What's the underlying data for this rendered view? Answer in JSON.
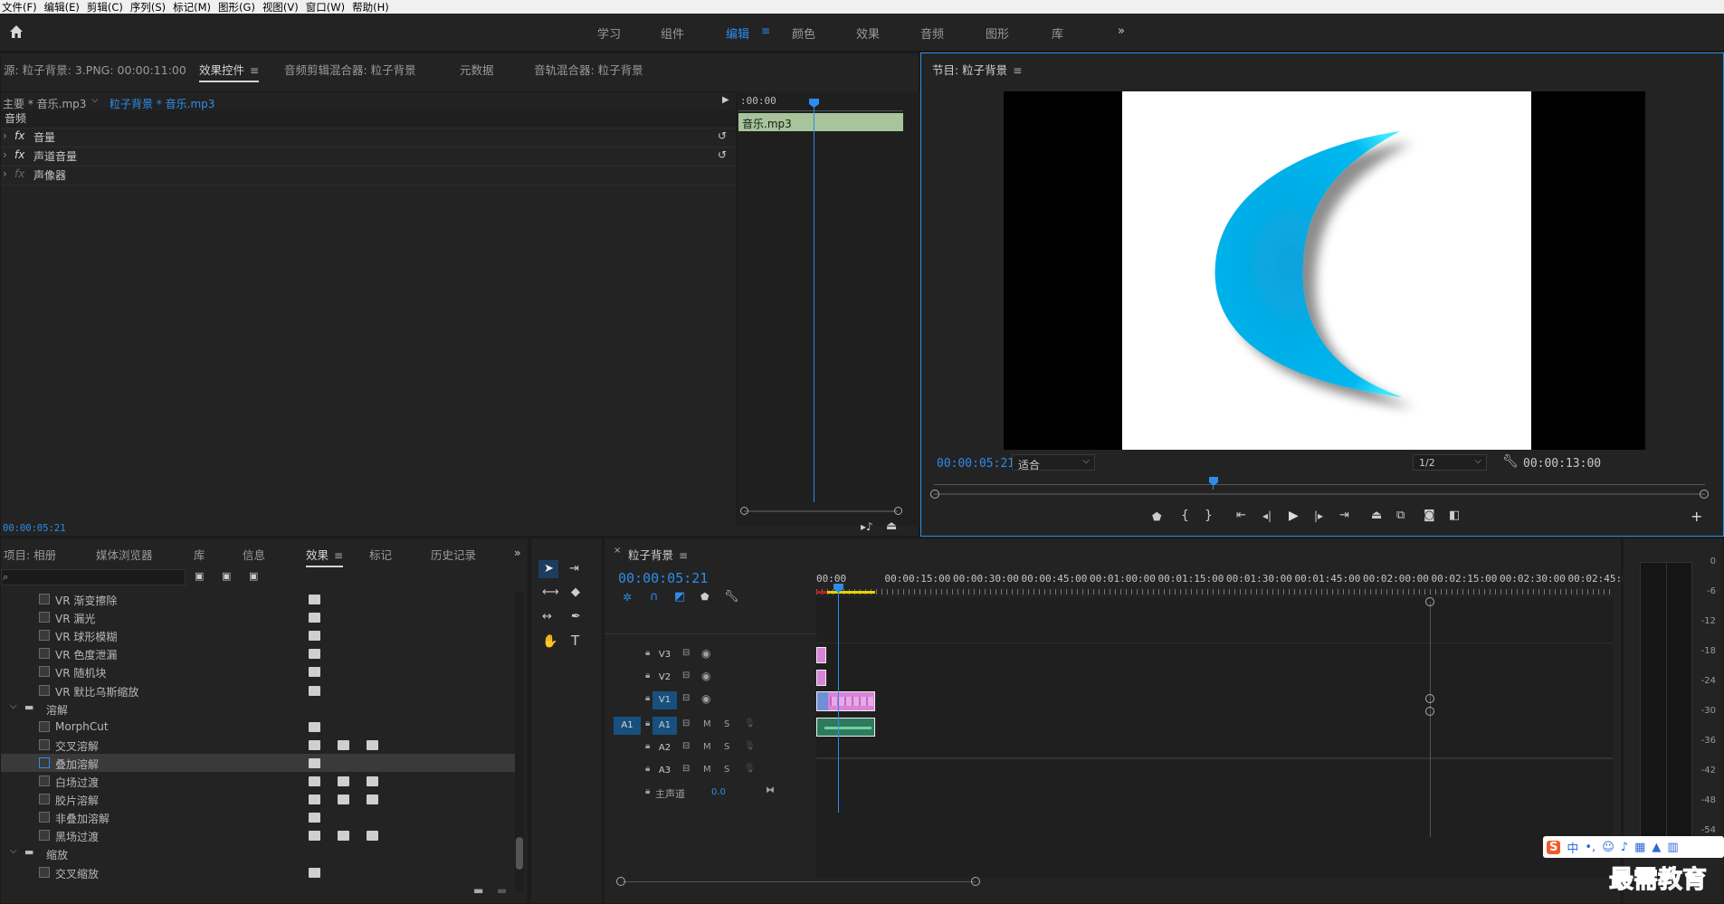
{
  "menu": [
    "文件(F)",
    "编辑(E)",
    "剪辑(C)",
    "序列(S)",
    "标记(M)",
    "图形(G)",
    "视图(V)",
    "窗口(W)",
    "帮助(H)"
  ],
  "workspaces": [
    "学习",
    "组件",
    "编辑",
    "颜色",
    "效果",
    "音频",
    "图形",
    "库"
  ],
  "workspace_active": "编辑",
  "source_panel": {
    "tabs": [
      "源: 粒子背景: 3.PNG: 00:00:11:00",
      "效果控件",
      "音频剪辑混合器: 粒子背景",
      "元数据",
      "音轨混合器: 粒子背景"
    ],
    "clip_master": "主要 * 音乐.mp3",
    "clip_active": "粒子背景 * 音乐.mp3",
    "timecode_start": ":00:00",
    "clip_bar": "音乐.mp3",
    "section": "音频",
    "effects": [
      "音量",
      "声道音量",
      "声像器"
    ],
    "timecode": "00:00:05:21"
  },
  "program": {
    "title": "节目: 粒子背景",
    "timecode": "00:00:05:21",
    "fit": "适合",
    "resolution": "1/2",
    "duration": "00:00:13:00"
  },
  "project_panel": {
    "tabs": [
      "项目: 相册",
      "媒体浏览器",
      "库",
      "信息",
      "效果",
      "标记",
      "历史记录"
    ],
    "active_tab": "效果",
    "items": [
      {
        "label": "VR 渐变擦除",
        "prefix": ""
      },
      {
        "label": "VR 漏光",
        "prefix": ""
      },
      {
        "label": "VR 球形模糊",
        "prefix": ""
      },
      {
        "label": "VR 色度泄漏",
        "prefix": ""
      },
      {
        "label": "VR 随机块",
        "prefix": ""
      },
      {
        "label": "VR 默比乌斯缩放",
        "prefix": ""
      },
      {
        "label": "溶解",
        "folder": true
      },
      {
        "label": "MorphCut"
      },
      {
        "label": "交叉溶解"
      },
      {
        "label": "叠加溶解",
        "selected": true
      },
      {
        "label": "白场过渡"
      },
      {
        "label": "胶片溶解"
      },
      {
        "label": "非叠加溶解"
      },
      {
        "label": "黑场过渡"
      },
      {
        "label": "缩放",
        "folder": true
      },
      {
        "label": "交叉缩放"
      }
    ]
  },
  "timeline": {
    "title": "粒子背景",
    "timecode": "00:00:05:21",
    "ruler": [
      "00:00",
      "00:00:15:00",
      "00:00:30:00",
      "00:00:45:00",
      "00:01:00:00",
      "00:01:15:00",
      "00:01:30:00",
      "00:01:45:00",
      "00:02:00:00",
      "00:02:15:00",
      "00:02:30:00",
      "00:02:45:00"
    ],
    "video_tracks": [
      "V3",
      "V2",
      "V1"
    ],
    "audio_tracks": [
      "A1",
      "A2",
      "A3"
    ],
    "source_patch": "A1",
    "mute": "M",
    "solo": "S",
    "master_label": "主声道",
    "master_value": "0.0"
  },
  "meter_labels": [
    "0",
    "-6",
    "-12",
    "-18",
    "-24",
    "-30",
    "-36",
    "-42",
    "-48",
    "-54"
  ],
  "ime": {
    "label": "中"
  },
  "watermark": "最需教育",
  "colors": {
    "accent": "#2d8ceb",
    "moon": "#00b4ee",
    "video_clip": "#d884d8",
    "audio_clip": "#2e7a5e",
    "clip_bar": "#a7c49a"
  }
}
